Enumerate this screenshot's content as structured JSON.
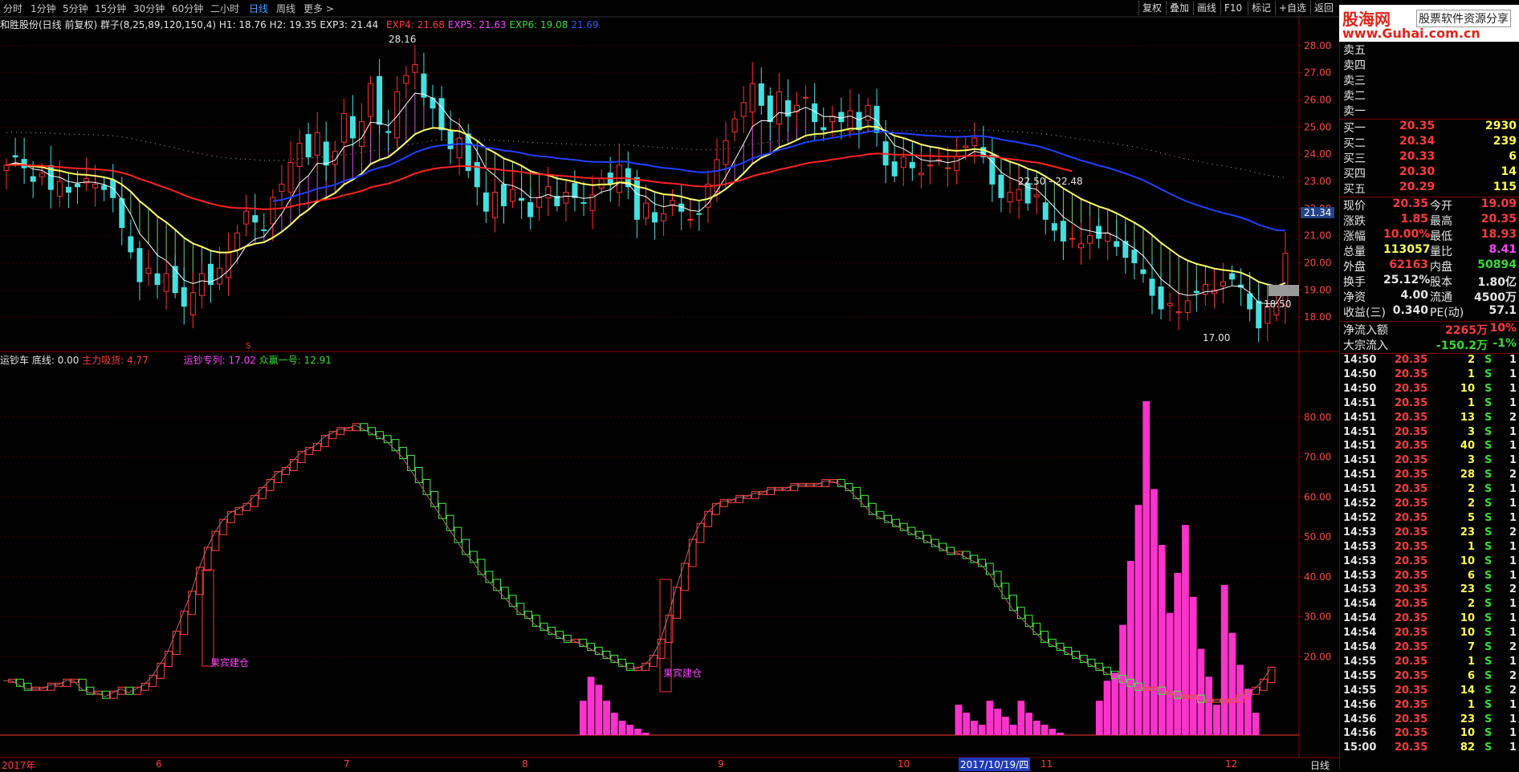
{
  "toolbar": {
    "tabs": [
      "分时",
      "1分钟",
      "5分钟",
      "15分钟",
      "30分钟",
      "60分钟",
      "二小时",
      "日线",
      "周线",
      "更多 >"
    ],
    "active_index": 7,
    "right_buttons": [
      "复权",
      "叠加",
      "画线",
      "F10",
      "标记",
      "+自选",
      "返回"
    ]
  },
  "brand": {
    "name": "股海网",
    "slogan": "股票软件资源分享",
    "url": "www.Guhai.com.cn"
  },
  "stock_info": {
    "name": "和胜股份(日线 前复权)",
    "indicator": "群子(8,25,89,120,150,4)",
    "h1": "H1: 18.76",
    "h2": "H2: 19.35",
    "exp3": "EXP3: 21.44",
    "exp4": "EXP4: 21.68",
    "exp5": "EXP5: 21.63",
    "exp6": "EXP6: 19.08",
    "extra": "21.69"
  },
  "sub_info": {
    "name": "运钞车",
    "base": "底线: 0.00",
    "main": "主力吸货: 4.77",
    "train": "运钞专列: 17.02",
    "crowd": "众赢一号: 12.91"
  },
  "annotations": {
    "high": "28.16",
    "low": "17.00",
    "mid": "22.50 - 22.48",
    "current": "21.34",
    "right": "18.50",
    "build1": "果宾建仓",
    "build2": "果宾建仓",
    "marker": "S"
  },
  "date_axis": {
    "labels": [
      "2017年",
      "6",
      "7",
      "8",
      "9",
      "10",
      "2017/10/19/四",
      "11",
      "12"
    ],
    "period": "日线"
  },
  "quote": {
    "asks": [
      {
        "label": "卖五"
      },
      {
        "label": "卖四"
      },
      {
        "label": "卖三"
      },
      {
        "label": "卖二"
      },
      {
        "label": "卖一"
      }
    ],
    "bids": [
      {
        "label": "买一",
        "price": "20.35",
        "vol": "2930"
      },
      {
        "label": "买二",
        "price": "20.34",
        "vol": "239"
      },
      {
        "label": "买三",
        "price": "20.33",
        "vol": "6"
      },
      {
        "label": "买四",
        "price": "20.30",
        "vol": "14"
      },
      {
        "label": "买五",
        "price": "20.29",
        "vol": "115"
      }
    ],
    "stats": [
      [
        "现价",
        "20.35",
        "今开",
        "19.09"
      ],
      [
        "涨跌",
        "1.85",
        "最高",
        "20.35"
      ],
      [
        "涨幅",
        "10.00%",
        "最低",
        "18.93"
      ],
      [
        "总量",
        "113057",
        "量比",
        "8.41"
      ],
      [
        "外盘",
        "62163",
        "内盘",
        "50894"
      ],
      [
        "换手",
        "25.12%",
        "股本",
        "1.80亿"
      ],
      [
        "净资",
        "4.00",
        "流通",
        "4500万"
      ],
      [
        "收益(三)",
        "0.340",
        "PE(动)",
        "57.1"
      ]
    ],
    "flows": [
      [
        "净流入额",
        "2265万",
        "10%"
      ],
      [
        "大宗流入",
        "-150.2万",
        "-1%"
      ]
    ]
  },
  "ticks": [
    [
      "14:50",
      "20.35",
      "2",
      "S",
      "1"
    ],
    [
      "14:50",
      "20.35",
      "1",
      "S",
      "1"
    ],
    [
      "14:50",
      "20.35",
      "10",
      "S",
      "1"
    ],
    [
      "14:51",
      "20.35",
      "1",
      "S",
      "1"
    ],
    [
      "14:51",
      "20.35",
      "13",
      "S",
      "2"
    ],
    [
      "14:51",
      "20.35",
      "3",
      "S",
      "1"
    ],
    [
      "14:51",
      "20.35",
      "40",
      "S",
      "1"
    ],
    [
      "14:51",
      "20.35",
      "3",
      "S",
      "1"
    ],
    [
      "14:51",
      "20.35",
      "28",
      "S",
      "2"
    ],
    [
      "14:51",
      "20.35",
      "2",
      "S",
      "1"
    ],
    [
      "14:52",
      "20.35",
      "2",
      "S",
      "1"
    ],
    [
      "14:52",
      "20.35",
      "5",
      "S",
      "1"
    ],
    [
      "14:53",
      "20.35",
      "23",
      "S",
      "2"
    ],
    [
      "14:53",
      "20.35",
      "1",
      "S",
      "1"
    ],
    [
      "14:53",
      "20.35",
      "10",
      "S",
      "1"
    ],
    [
      "14:53",
      "20.35",
      "6",
      "S",
      "1"
    ],
    [
      "14:53",
      "20.35",
      "23",
      "S",
      "2"
    ],
    [
      "14:54",
      "20.35",
      "2",
      "S",
      "1"
    ],
    [
      "14:54",
      "20.35",
      "10",
      "S",
      "1"
    ],
    [
      "14:54",
      "20.35",
      "10",
      "S",
      "1"
    ],
    [
      "14:54",
      "20.35",
      "7",
      "S",
      "2"
    ],
    [
      "14:55",
      "20.35",
      "1",
      "S",
      "1"
    ],
    [
      "14:55",
      "20.35",
      "6",
      "S",
      "2"
    ],
    [
      "14:55",
      "20.35",
      "14",
      "S",
      "2"
    ],
    [
      "14:56",
      "20.35",
      "1",
      "S",
      "1"
    ],
    [
      "14:56",
      "20.35",
      "23",
      "S",
      "1"
    ],
    [
      "14:56",
      "20.35",
      "10",
      "S",
      "1"
    ],
    [
      "15:00",
      "20.35",
      "82",
      "S",
      "1"
    ]
  ],
  "chart_data": [
    {
      "type": "candlestick",
      "title": "和胜股份(日线 前复权)",
      "ylim": [
        17.5,
        28.5
      ],
      "y_ticks": [
        18,
        19,
        20,
        21,
        22,
        23,
        24,
        25,
        26,
        27,
        28
      ],
      "closes": [
        23.6,
        23.9,
        23.5,
        23.0,
        23.3,
        22.7,
        23.0,
        22.6,
        22.8,
        23.1,
        22.9,
        22.7,
        22.4,
        21.3,
        20.4,
        19.3,
        19.8,
        19.2,
        19.6,
        18.9,
        18.4,
        18.9,
        19.6,
        19.2,
        19.8,
        20.4,
        21.1,
        21.9,
        21.5,
        21.2,
        22.4,
        22.9,
        23.7,
        24.4,
        23.9,
        24.8,
        23.6,
        24.1,
        25.5,
        24.6,
        25.2,
        26.6,
        25.1,
        24.8,
        26.3,
        26.9,
        27.3,
        26.1,
        25.7,
        24.9,
        24.2,
        24.6,
        23.4,
        22.8,
        21.9,
        22.6,
        22.1,
        22.7,
        22.3,
        21.7,
        22.4,
        22.8,
        22.1,
        22.6,
        22.4,
        22.2,
        22.5,
        23.1,
        22.9,
        23.6,
        22.8,
        21.6,
        22.2,
        21.5,
        21.8,
        22.3,
        21.9,
        21.6,
        21.8,
        22.9,
        23.8,
        24.5,
        25.3,
        25.9,
        26.6,
        25.8,
        25.2,
        26.3,
        25.4,
        25.8,
        26.1,
        25.2,
        24.9,
        25.4,
        25.2,
        25.6,
        24.9,
        25.8,
        24.8,
        23.6,
        23.2,
        23.9,
        23.5,
        23.3,
        23.6,
        23.8,
        23.5,
        23.9,
        24.3,
        24.6,
        23.9,
        22.9,
        22.4,
        22.6,
        22.7,
        22.2,
        22.5,
        21.6,
        21.2,
        20.8,
        20.9,
        20.7,
        21.0,
        20.9,
        21.1,
        20.6,
        20.2,
        20.0,
        19.6,
        18.8,
        18.3,
        18.5,
        18.2,
        18.6,
        18.9,
        19.2,
        19.0,
        19.3,
        19.4,
        19.1,
        18.3,
        17.6,
        18.4,
        18.5,
        20.35
      ],
      "series": [
        {
          "name": "EXP4",
          "color": "#ffff55"
        },
        {
          "name": "EXP5",
          "color": "#dd44dd"
        },
        {
          "name": "EXP6",
          "color": "#55ff55"
        }
      ]
    },
    {
      "type": "line",
      "title": "运钞车",
      "ylim": [
        0,
        90
      ],
      "y_ticks": [
        20,
        30,
        40,
        50,
        60,
        70,
        80
      ],
      "line": [
        14,
        14,
        13,
        12,
        12,
        12,
        13,
        13,
        14,
        14,
        12,
        11,
        11,
        10,
        11,
        12,
        11,
        12,
        13,
        15,
        18,
        21,
        26,
        31,
        36,
        42,
        47,
        51,
        54,
        56,
        57,
        58,
        60,
        62,
        64,
        66,
        67,
        69,
        71,
        72,
        73,
        75,
        76,
        77,
        77,
        78,
        77,
        76,
        75,
        74,
        72,
        70,
        67,
        64,
        61,
        58,
        55,
        52,
        49,
        46,
        44,
        41,
        39,
        37,
        35,
        33,
        31,
        30,
        28,
        27,
        26,
        25,
        24,
        24,
        23,
        22,
        21,
        20,
        19,
        18,
        17,
        17,
        18,
        20,
        24,
        30,
        37,
        43,
        49,
        53,
        56,
        58,
        59,
        59,
        60,
        60,
        61,
        61,
        62,
        62,
        62,
        63,
        63,
        63,
        63,
        64,
        64,
        63,
        62,
        60,
        58,
        56,
        55,
        54,
        53,
        52,
        51,
        50,
        49,
        48,
        47,
        46,
        46,
        45,
        44,
        43,
        41,
        38,
        35,
        32,
        30,
        28,
        26,
        24,
        23,
        22,
        21,
        20,
        19,
        18,
        17,
        16,
        15,
        14,
        13,
        12,
        12,
        12,
        11,
        11,
        10,
        10,
        10,
        9,
        9,
        9,
        9,
        9,
        10,
        11,
        12,
        14,
        17
      ],
      "bars": [
        0,
        0,
        0,
        0,
        0,
        0,
        0,
        0,
        0,
        0,
        0,
        0,
        9,
        16,
        23,
        12,
        8,
        5,
        3,
        11,
        9,
        6,
        4,
        3,
        2,
        1,
        0,
        0,
        0,
        0,
        0,
        0,
        0,
        0,
        0,
        0,
        0,
        0,
        0,
        0,
        0,
        0,
        0,
        0,
        0,
        0,
        0,
        0,
        0,
        0,
        0,
        0,
        0,
        0,
        0,
        0,
        0,
        0,
        0,
        0,
        0,
        0,
        0,
        0,
        0,
        0,
        0,
        0,
        0,
        0,
        0,
        0,
        0,
        0,
        0,
        0,
        0,
        0,
        0,
        0,
        0,
        0,
        0,
        0,
        0,
        0,
        0,
        0,
        0,
        0,
        0,
        0,
        0,
        0,
        0,
        0,
        0,
        0,
        0,
        0,
        0,
        0,
        0,
        0,
        0,
        0,
        0,
        0,
        0,
        0,
        0,
        0,
        0,
        0,
        0,
        0,
        0,
        0,
        0,
        0,
        0,
        0,
        0,
        0,
        0,
        0,
        0,
        0,
        0,
        0,
        0,
        0,
        0,
        0,
        0,
        0,
        0,
        0,
        0,
        0,
        0,
        0,
        0,
        0,
        0,
        0,
        0,
        0,
        0,
        0,
        0,
        0,
        0,
        0,
        0,
        0,
        0,
        0,
        0,
        0,
        0,
        0,
        0,
        0,
        0,
        0,
        0,
        0,
        0,
        0,
        0,
        0,
        0,
        0,
        0,
        0,
        0,
        0,
        0,
        0,
        0,
        0,
        0,
        0,
        0,
        0,
        0,
        0,
        0,
        0,
        0,
        0,
        0,
        0,
        0,
        0,
        0,
        0,
        0,
        0,
        0,
        0,
        0,
        0,
        0,
        0,
        0,
        0,
        0,
        0
      ],
      "bars2": [
        [
          74,
          9
        ],
        [
          75,
          15
        ],
        [
          76,
          13
        ],
        [
          77,
          9
        ],
        [
          78,
          6
        ],
        [
          79,
          4
        ],
        [
          80,
          3
        ],
        [
          81,
          2
        ],
        [
          82,
          1
        ],
        [
          122,
          8
        ],
        [
          123,
          6
        ],
        [
          124,
          4
        ],
        [
          125,
          3
        ],
        [
          126,
          9
        ],
        [
          127,
          7
        ],
        [
          128,
          5
        ],
        [
          129,
          3
        ],
        [
          130,
          9
        ],
        [
          131,
          6
        ],
        [
          132,
          4
        ],
        [
          133,
          3
        ],
        [
          134,
          2
        ],
        [
          135,
          1
        ],
        [
          140,
          9
        ],
        [
          141,
          14
        ],
        [
          142,
          16
        ],
        [
          143,
          28
        ],
        [
          144,
          44
        ],
        [
          145,
          58
        ],
        [
          146,
          84
        ],
        [
          147,
          62
        ],
        [
          148,
          48
        ],
        [
          149,
          31
        ],
        [
          150,
          41
        ],
        [
          151,
          53
        ],
        [
          152,
          35
        ],
        [
          153,
          22
        ],
        [
          154,
          15
        ],
        [
          155,
          8
        ],
        [
          156,
          38
        ],
        [
          157,
          26
        ],
        [
          158,
          18
        ],
        [
          159,
          12
        ],
        [
          160,
          6
        ]
      ]
    }
  ]
}
